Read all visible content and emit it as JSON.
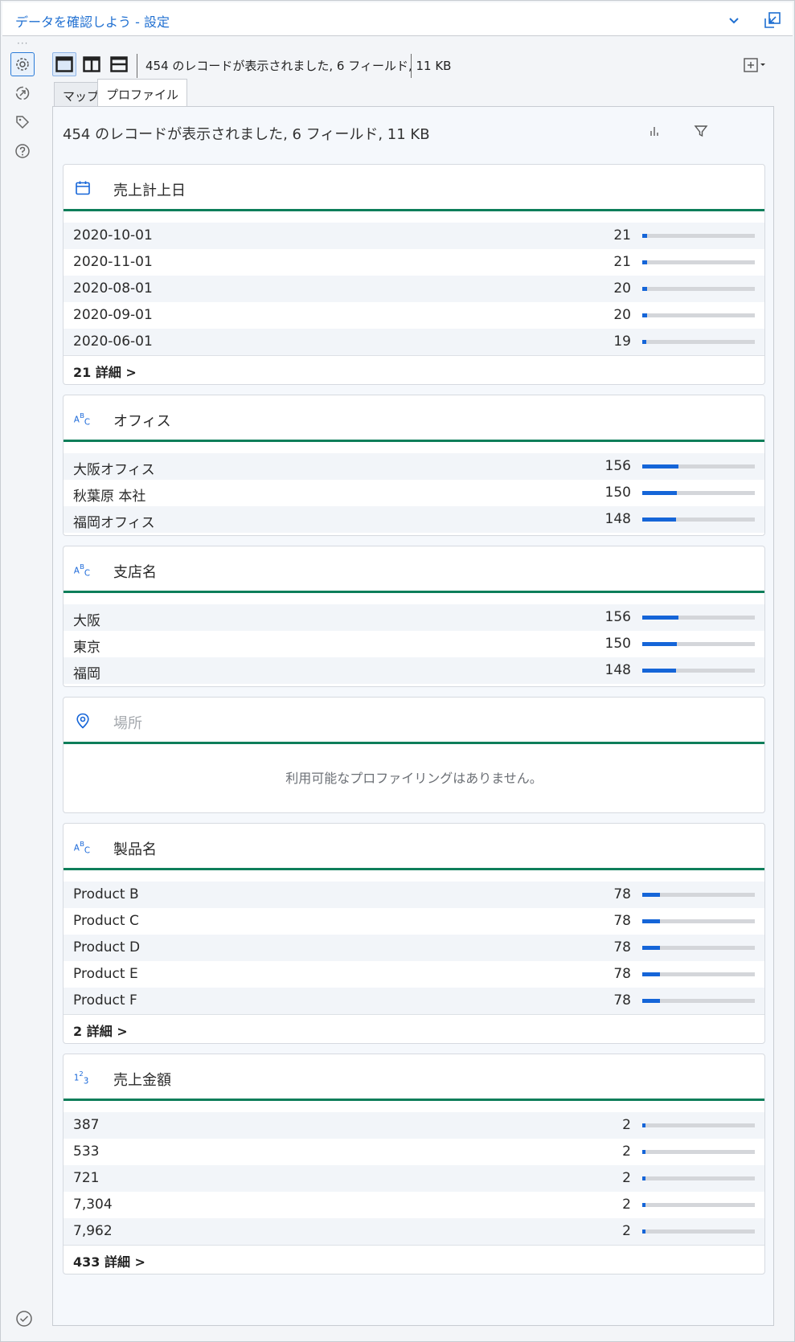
{
  "window": {
    "title": "データを確認しよう - 設定"
  },
  "toolbar": {
    "status": "454 のレコードが表示されました, 6 フィールド, 11 KB"
  },
  "tabs": [
    {
      "label": "マップ",
      "active": false
    },
    {
      "label": "プロファイル",
      "active": true
    }
  ],
  "panel": {
    "header": "454 のレコードが表示されました, 6 フィールド, 11 KB"
  },
  "colors": {
    "accent": "#1565d8",
    "divider": "#0e7e5a",
    "title": "#1f6fd1"
  },
  "fields": [
    {
      "name": "売上計上日",
      "icon": "calendar-icon",
      "rows": [
        {
          "label": "2020-10-01",
          "count": "21",
          "fraction": 0.046
        },
        {
          "label": "2020-11-01",
          "count": "21",
          "fraction": 0.046
        },
        {
          "label": "2020-08-01",
          "count": "20",
          "fraction": 0.044
        },
        {
          "label": "2020-09-01",
          "count": "20",
          "fraction": 0.044
        },
        {
          "label": "2020-06-01",
          "count": "19",
          "fraction": 0.042
        }
      ],
      "more": "21 詳細 >"
    },
    {
      "name": "オフィス",
      "icon": "abc-string-icon",
      "rows": [
        {
          "label": "大阪オフィス",
          "count": "156",
          "fraction": 0.344
        },
        {
          "label": "秋葉原 本社",
          "count": "150",
          "fraction": 0.33
        },
        {
          "label": "福岡オフィス",
          "count": "148",
          "fraction": 0.326
        }
      ],
      "more": ""
    },
    {
      "name": "支店名",
      "icon": "abc-string-icon",
      "rows": [
        {
          "label": "大阪",
          "count": "156",
          "fraction": 0.344
        },
        {
          "label": "東京",
          "count": "150",
          "fraction": 0.33
        },
        {
          "label": "福岡",
          "count": "148",
          "fraction": 0.326
        }
      ],
      "more": ""
    },
    {
      "name": "場所",
      "icon": "location-pin-icon",
      "muted": true,
      "empty": "利用可能なプロファイリングはありません。",
      "rows": [],
      "more": ""
    },
    {
      "name": "製品名",
      "icon": "abc-string-icon",
      "rows": [
        {
          "label": "Product B",
          "count": "78",
          "fraction": 0.172
        },
        {
          "label": "Product C",
          "count": "78",
          "fraction": 0.172
        },
        {
          "label": "Product D",
          "count": "78",
          "fraction": 0.172
        },
        {
          "label": "Product E",
          "count": "78",
          "fraction": 0.172
        },
        {
          "label": "Product F",
          "count": "78",
          "fraction": 0.172
        }
      ],
      "more": "2 詳細 >"
    },
    {
      "name": "売上金額",
      "icon": "numeric-123-icon",
      "rows": [
        {
          "label": "387",
          "count": "2",
          "fraction": 0.004
        },
        {
          "label": "533",
          "count": "2",
          "fraction": 0.004
        },
        {
          "label": "721",
          "count": "2",
          "fraction": 0.004
        },
        {
          "label": "7,304",
          "count": "2",
          "fraction": 0.004
        },
        {
          "label": "7,962",
          "count": "2",
          "fraction": 0.004
        }
      ],
      "more": "433 詳細 >"
    }
  ]
}
